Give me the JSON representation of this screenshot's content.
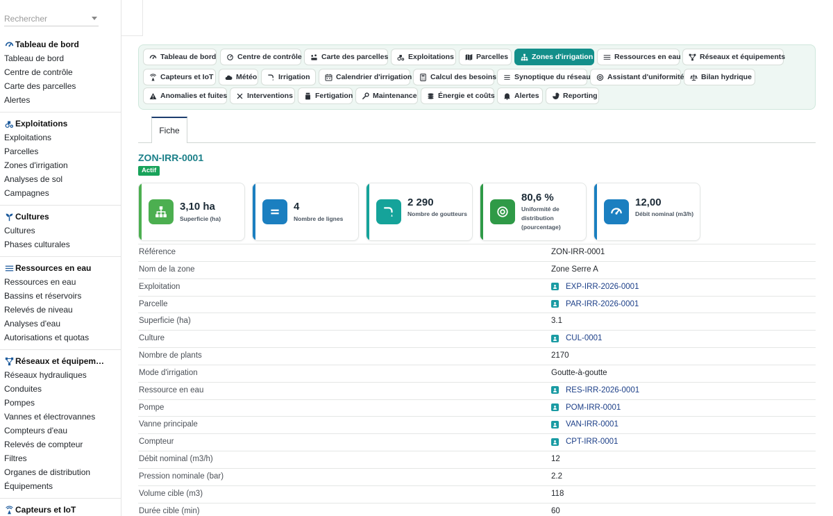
{
  "search": {
    "placeholder": "Rechercher"
  },
  "sidebar": {
    "sections": [
      {
        "title": "Tableau de bord",
        "icon": "gauge-icon",
        "items": [
          "Tableau de bord",
          "Centre de contrôle",
          "Carte des parcelles",
          "Alertes"
        ]
      },
      {
        "title": "Exploitations",
        "icon": "tractor-icon",
        "items": [
          "Exploitations",
          "Parcelles",
          "Zones d'irrigation",
          "Analyses de sol",
          "Campagnes"
        ]
      },
      {
        "title": "Cultures",
        "icon": "seedling-icon",
        "items": [
          "Cultures",
          "Phases culturales"
        ]
      },
      {
        "title": "Ressources en eau",
        "icon": "water-icon",
        "items": [
          "Ressources en eau",
          "Bassins et réservoirs",
          "Relevés de niveau",
          "Analyses d'eau",
          "Autorisations et quotas"
        ]
      },
      {
        "title": "Réseaux et équipem…",
        "icon": "network-icon",
        "items": [
          "Réseaux hydrauliques",
          "Conduites",
          "Pompes",
          "Vannes et électrovannes",
          "Compteurs d'eau",
          "Relevés de compteur",
          "Filtres",
          "Organes de distribution",
          "Équipements"
        ]
      },
      {
        "title": "Capteurs et IoT",
        "icon": "sensor-icon",
        "items": []
      }
    ]
  },
  "toolbar": {
    "rows": [
      [
        {
          "label": "Tableau de bord",
          "icon": "gauge-icon"
        },
        {
          "label": "Centre de contrôle",
          "icon": "dial-icon"
        },
        {
          "label": "Carte des parcelles",
          "icon": "map-icon"
        },
        {
          "label": "Exploitations",
          "icon": "tractor-icon"
        },
        {
          "label": "Parcelles",
          "icon": "folded-map-icon"
        },
        {
          "label": "Zones d'irrigation",
          "icon": "sitemap-icon",
          "active": true
        },
        {
          "label": "Ressources en eau",
          "icon": "water-icon"
        },
        {
          "label": "Réseaux et équipements",
          "icon": "network-icon"
        }
      ],
      [
        {
          "label": "Capteurs et IoT",
          "icon": "sensor-icon"
        },
        {
          "label": "Météo",
          "icon": "cloud-icon"
        },
        {
          "label": "Irrigation",
          "icon": "faucet-icon"
        },
        {
          "label": "Calendrier d'irrigation",
          "icon": "calendar-icon"
        },
        {
          "label": "Calcul des besoins",
          "icon": "calculator-icon"
        },
        {
          "label": "Synoptique du réseau",
          "icon": "list-icon"
        },
        {
          "label": "Assistant d'uniformité",
          "icon": "target-icon"
        },
        {
          "label": "Bilan hydrique",
          "icon": "scale-icon"
        }
      ],
      [
        {
          "label": "Anomalies et fuites",
          "icon": "warning-icon"
        },
        {
          "label": "Interventions",
          "icon": "tools-icon"
        },
        {
          "label": "Fertigation",
          "icon": "bottle-icon"
        },
        {
          "label": "Maintenance",
          "icon": "wrench-icon"
        },
        {
          "label": "Énergie et coûts",
          "icon": "coins-icon"
        },
        {
          "label": "Alertes",
          "icon": "bell-icon"
        },
        {
          "label": "Reporting",
          "icon": "pie-icon"
        }
      ]
    ]
  },
  "tabs": {
    "fiche": "Fiche"
  },
  "record": {
    "title": "ZON-IRR-0001",
    "status": "Actif"
  },
  "kpis": [
    {
      "value": "3,10 ha",
      "label": "Superficie (ha)",
      "color": "#4caf50",
      "icon": "sitemap-icon"
    },
    {
      "value": "4",
      "label": "Nombre de lignes",
      "color": "#1b7fc0",
      "icon": "equals-icon"
    },
    {
      "value": "2 290",
      "label": "Nombre de goutteurs",
      "color": "#15a39a",
      "icon": "faucet-icon"
    },
    {
      "value": "80,6 %",
      "label": "Uniformité de distribution (pourcentage)",
      "color": "#2f9a47",
      "icon": "target-icon"
    },
    {
      "value": "12,00",
      "label": "Débit nominal (m3/h)",
      "color": "#1b7fc0",
      "icon": "gauge-icon"
    }
  ],
  "fields": [
    {
      "key": "Référence",
      "value": "ZON-IRR-0001",
      "link": false
    },
    {
      "key": "Nom de la zone",
      "value": "Zone Serre A",
      "link": false
    },
    {
      "key": "Exploitation",
      "value": "EXP-IRR-2026-0001",
      "link": true
    },
    {
      "key": "Parcelle",
      "value": "PAR-IRR-2026-0001",
      "link": true
    },
    {
      "key": "Superficie (ha)",
      "value": "3.1",
      "link": false
    },
    {
      "key": "Culture",
      "value": "CUL-0001",
      "link": true
    },
    {
      "key": "Nombre de plants",
      "value": "2170",
      "link": false
    },
    {
      "key": "Mode d'irrigation",
      "value": "Goutte-à-goutte",
      "link": false
    },
    {
      "key": "Ressource en eau",
      "value": "RES-IRR-2026-0001",
      "link": true
    },
    {
      "key": "Pompe",
      "value": "POM-IRR-0001",
      "link": true
    },
    {
      "key": "Vanne principale",
      "value": "VAN-IRR-0001",
      "link": true
    },
    {
      "key": "Compteur",
      "value": "CPT-IRR-0001",
      "link": true
    },
    {
      "key": "Débit nominal (m3/h)",
      "value": "12",
      "link": false
    },
    {
      "key": "Pression nominale (bar)",
      "value": "2.2",
      "link": false
    },
    {
      "key": "Volume cible (m3)",
      "value": "118",
      "link": false
    },
    {
      "key": "Durée cible (min)",
      "value": "60",
      "link": false
    }
  ]
}
